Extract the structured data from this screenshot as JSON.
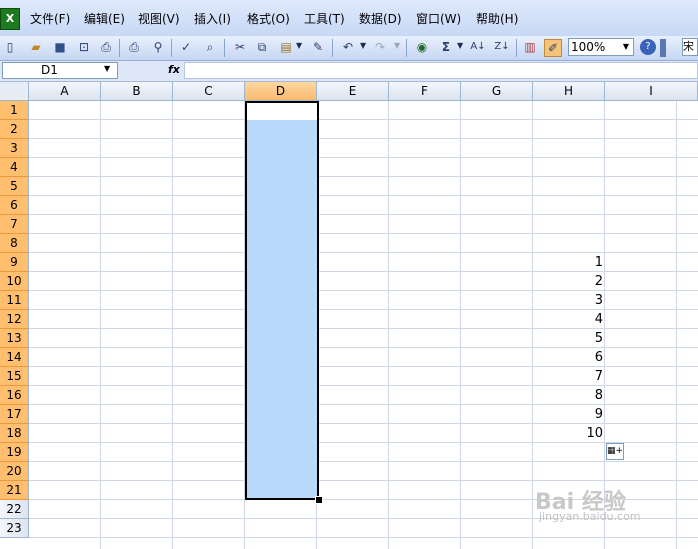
{
  "menubar": {
    "items": [
      "文件(F)",
      "编辑(E)",
      "视图(V)",
      "插入(I)",
      "格式(O)",
      "工具(T)",
      "数据(D)",
      "窗口(W)",
      "帮助(H)"
    ]
  },
  "toolbar": {
    "zoom": "100%",
    "font_name": "宋",
    "sigma": "Σ",
    "icons": [
      "new-icon",
      "open-icon",
      "save-icon",
      "permission-icon",
      "print-icon",
      "print-preview-icon",
      "spelling-icon",
      "research-icon",
      "cut-icon",
      "copy-icon",
      "paste-icon",
      "format-painter-icon",
      "undo-icon",
      "redo-icon",
      "hyperlink-icon",
      "autosum-icon",
      "sort-ascending-icon",
      "sort-descending-icon",
      "chart-wizard-icon",
      "drawing-icon",
      "help-icon"
    ]
  },
  "formulabar": {
    "name_box": "D1",
    "fx_label": "fx",
    "formula": ""
  },
  "sheet": {
    "columns": [
      "A",
      "B",
      "C",
      "D",
      "E",
      "F",
      "G",
      "H",
      "I"
    ],
    "rows": [
      "1",
      "2",
      "3",
      "4",
      "5",
      "6",
      "7",
      "8",
      "9",
      "10",
      "11",
      "12",
      "13",
      "14",
      "15",
      "16",
      "17",
      "18",
      "19",
      "20",
      "21",
      "22",
      "23"
    ],
    "selected_column": "D",
    "selected_range": "D1:D21",
    "column_h_values": [
      "1",
      "2",
      "3",
      "4",
      "5",
      "6",
      "7",
      "8",
      "9",
      "10"
    ],
    "column_h_start_row": 9
  },
  "watermark": {
    "text": "Bai 经验",
    "sub": "jingyan.baidu.com"
  },
  "colors": {
    "selection_fill": "#b9d9fa",
    "header_highlight": "#ffbf6f",
    "gridline": "#d0d7e5"
  }
}
